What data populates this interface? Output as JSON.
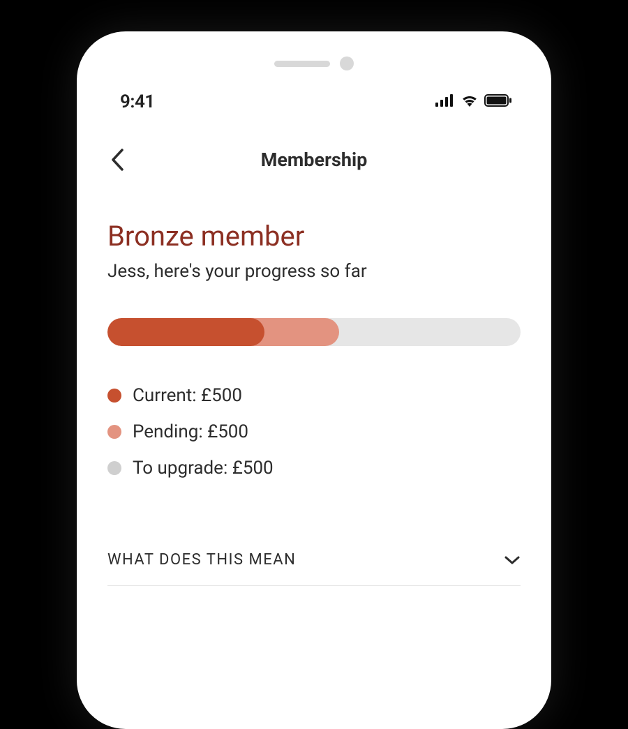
{
  "status_bar": {
    "time": "9:41"
  },
  "header": {
    "title": "Membership"
  },
  "membership": {
    "tier_title": "Bronze member",
    "subtitle": "Jess, here's your progress so far",
    "progress": {
      "current_percent": 38,
      "pending_percent": 56
    },
    "legend": {
      "current": {
        "label": "Current: £500",
        "color": "#c6502f"
      },
      "pending": {
        "label": "Pending: £500",
        "color": "#e39380"
      },
      "to_upgrade": {
        "label": "To upgrade: £500",
        "color": "#cfcfcf"
      }
    }
  },
  "accordion": {
    "what_does_this_mean": "WHAT DOES THIS MEAN"
  }
}
